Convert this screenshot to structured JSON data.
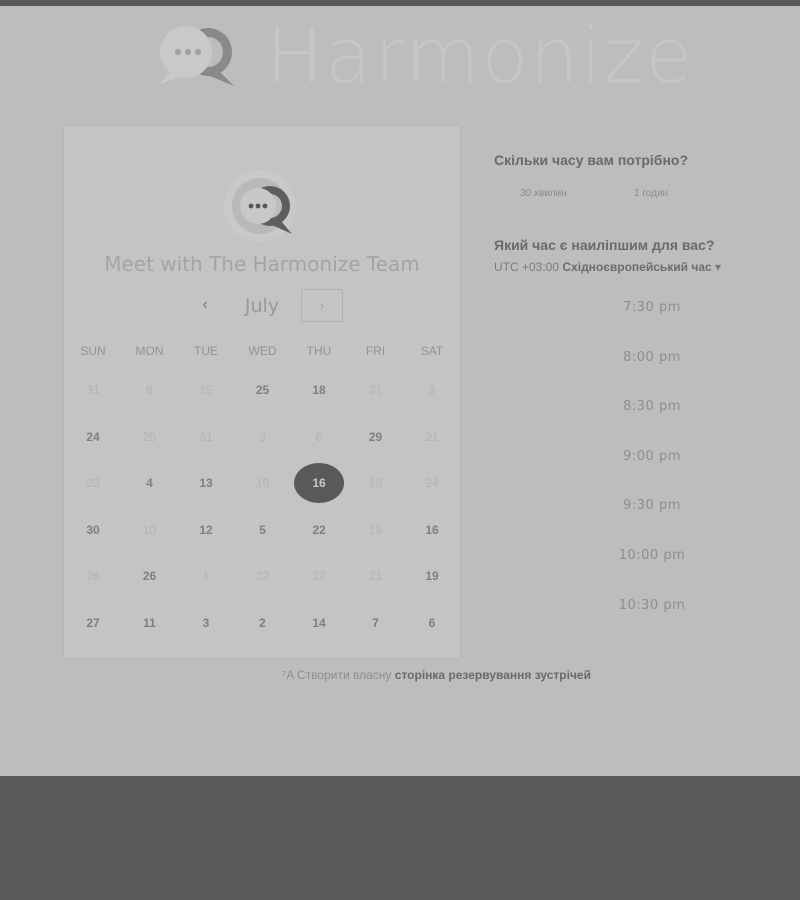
{
  "header": {
    "brand_name": "Harmonize"
  },
  "calendar": {
    "title": "Meet with The Harmonize Team",
    "month": "July",
    "prev_icon": "‹",
    "next_icon": "›",
    "weekdays": [
      "SUN",
      "MON",
      "TUE",
      "WED",
      "THU",
      "FRI",
      "SAT"
    ],
    "weeks": [
      [
        {
          "d": "31",
          "s": "dim"
        },
        {
          "d": "8",
          "s": "dim"
        },
        {
          "d": "15",
          "s": "dim"
        },
        {
          "d": "25",
          "s": "active"
        },
        {
          "d": "18",
          "s": "active"
        },
        {
          "d": "21",
          "s": "dim"
        },
        {
          "d": "9",
          "s": "dim"
        }
      ],
      [
        {
          "d": "24",
          "s": "active"
        },
        {
          "d": "25",
          "s": "dim"
        },
        {
          "d": "31",
          "s": "dim"
        },
        {
          "d": "3",
          "s": "dim"
        },
        {
          "d": "6",
          "s": "dim"
        },
        {
          "d": "29",
          "s": "active"
        },
        {
          "d": "21",
          "s": "dim"
        }
      ],
      [
        {
          "d": "23",
          "s": "dim"
        },
        {
          "d": "4",
          "s": "active"
        },
        {
          "d": "13",
          "s": "active"
        },
        {
          "d": "10",
          "s": "dim"
        },
        {
          "d": "16",
          "s": "selected"
        },
        {
          "d": "18",
          "s": "dim"
        },
        {
          "d": "24",
          "s": "dim"
        }
      ],
      [
        {
          "d": "30",
          "s": "active"
        },
        {
          "d": "10",
          "s": "dim"
        },
        {
          "d": "12",
          "s": "active"
        },
        {
          "d": "5",
          "s": "active"
        },
        {
          "d": "22",
          "s": "active"
        },
        {
          "d": "18",
          "s": "dim"
        },
        {
          "d": "16",
          "s": "active"
        }
      ],
      [
        {
          "d": "26",
          "s": "dim"
        },
        {
          "d": "26",
          "s": "active"
        },
        {
          "d": "1",
          "s": "dim"
        },
        {
          "d": "22",
          "s": "dim"
        },
        {
          "d": "27",
          "s": "dim"
        },
        {
          "d": "21",
          "s": "dim"
        },
        {
          "d": "19",
          "s": "active"
        }
      ],
      [
        {
          "d": "27",
          "s": "active"
        },
        {
          "d": "11",
          "s": "active"
        },
        {
          "d": "3",
          "s": "active"
        },
        {
          "d": "2",
          "s": "active"
        },
        {
          "d": "14",
          "s": "active"
        },
        {
          "d": "7",
          "s": "active"
        },
        {
          "d": "6",
          "s": "active"
        }
      ]
    ]
  },
  "duration": {
    "question": "Скільки часу вам потрібно?",
    "options": [
      "30 хвилин",
      "1 годин"
    ]
  },
  "time": {
    "question": "Який час є наиліпшим для вас?",
    "timezone_offset": "UTC +03:00",
    "timezone_name": "Східноєвропейський час",
    "timezone_caret": "▾",
    "slots": [
      "7:30 pm",
      "8:00 pm",
      "8:30 pm",
      "9:00 pm",
      "9:30 pm",
      "10:00 pm",
      "10:30 pm"
    ]
  },
  "footer": {
    "icon": "⁷A",
    "text": "Створити власну",
    "link": "сторінка резервування зустрічей"
  }
}
